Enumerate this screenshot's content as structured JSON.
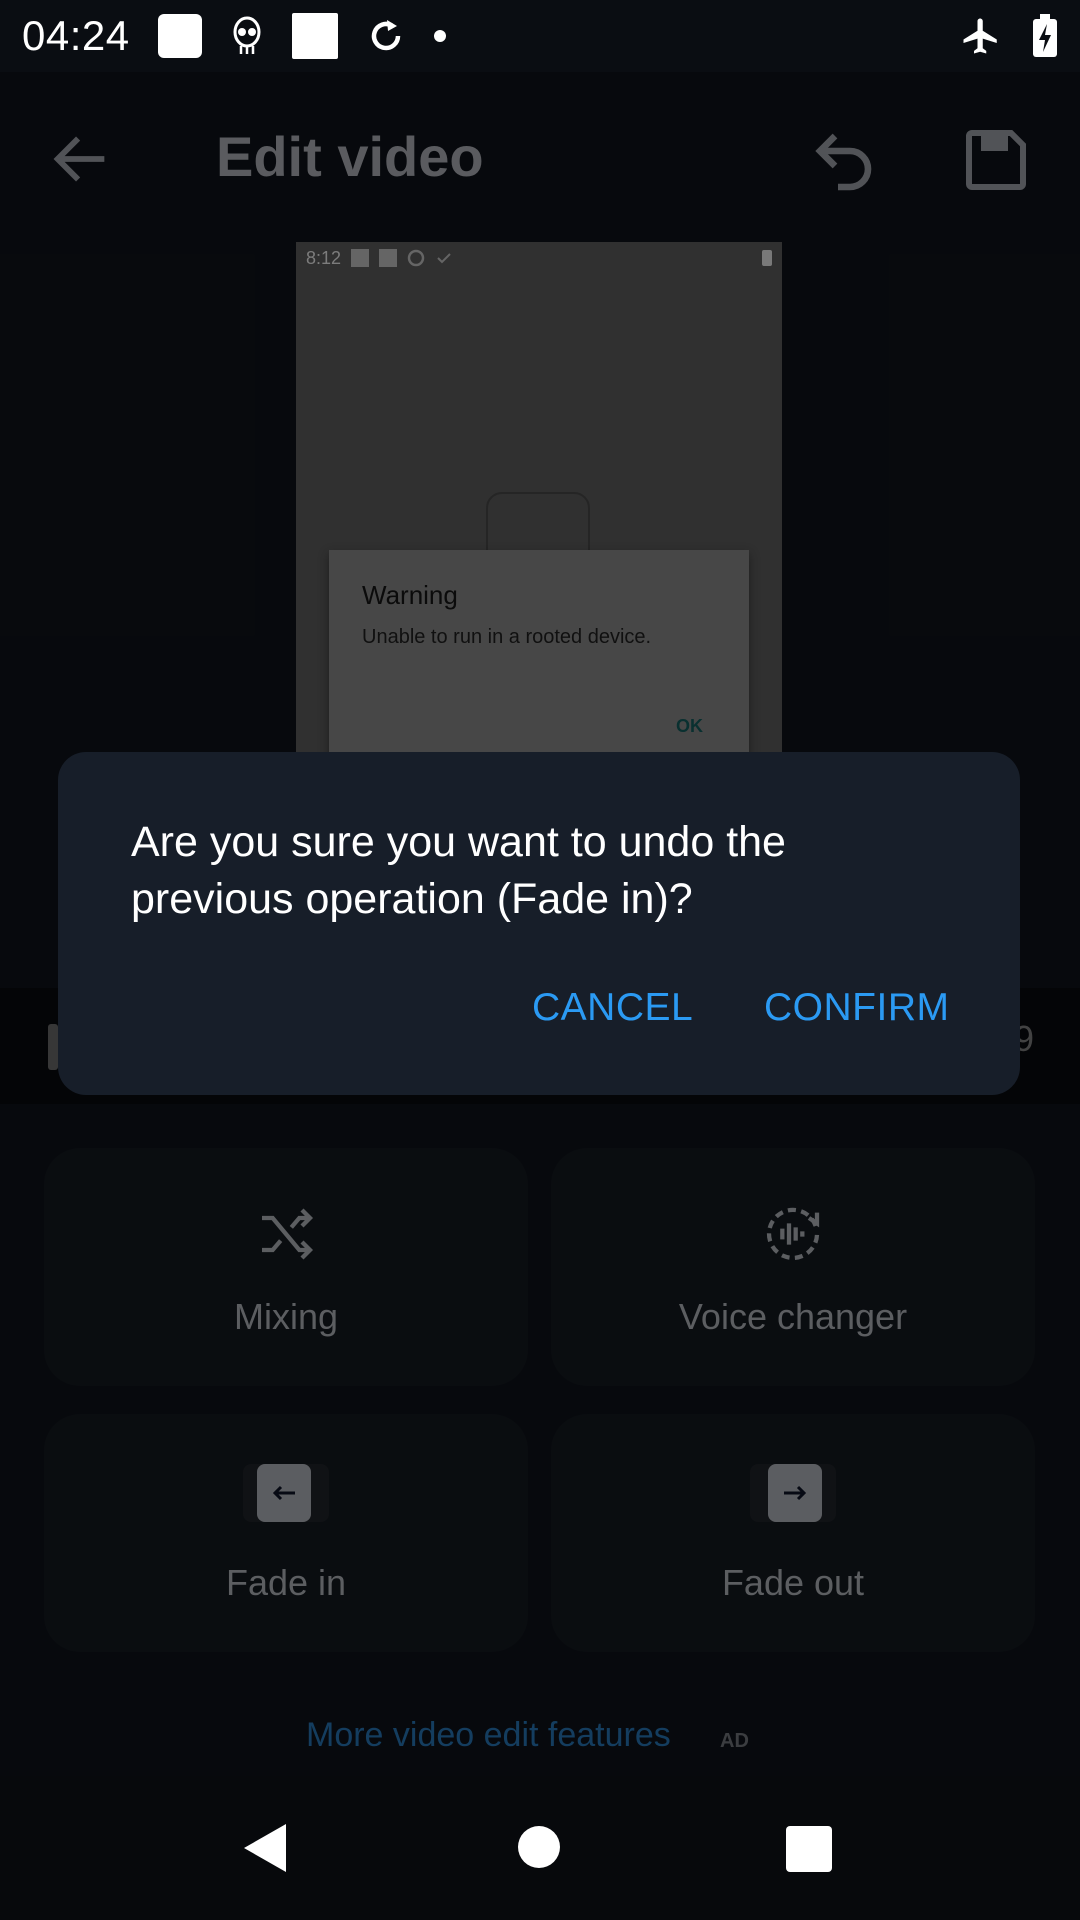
{
  "status_bar": {
    "time": "04:24",
    "icons_left": [
      "square-notification-icon",
      "alien-icon",
      "square-notification-icon",
      "sync-icon",
      "dot-icon"
    ],
    "icons_right": [
      "airplane-mode-icon",
      "battery-charging-icon"
    ]
  },
  "app_bar": {
    "title": "Edit video",
    "back_icon": "arrow-left-icon",
    "undo_icon": "undo-icon",
    "save_icon": "floppy-disk-icon"
  },
  "preview": {
    "inner_status_time": "8:12",
    "warning_title": "Warning",
    "warning_message": "Unable to run in a rooted device.",
    "warning_ok": "OK"
  },
  "timeline": {
    "end_fragment": "9"
  },
  "features": [
    {
      "label": "Mixing",
      "icon": "shuffle-icon"
    },
    {
      "label": "Voice changer",
      "icon": "voice-wave-icon"
    },
    {
      "label": "Fade in",
      "icon": "fade-in-icon"
    },
    {
      "label": "Fade out",
      "icon": "fade-out-icon"
    }
  ],
  "more_link": {
    "label": "More video edit features",
    "ad": "AD"
  },
  "dialog": {
    "message": "Are you sure you want to undo the previous operation (Fade in)?",
    "cancel_label": "CANCEL",
    "confirm_label": "CONFIRM"
  },
  "colors": {
    "accent": "#2b9af3",
    "dialog_bg": "#171e29",
    "link": "#1f5f92"
  },
  "nav_bar": {
    "icons": [
      "back-triangle-icon",
      "home-circle-icon",
      "recents-square-icon"
    ]
  }
}
